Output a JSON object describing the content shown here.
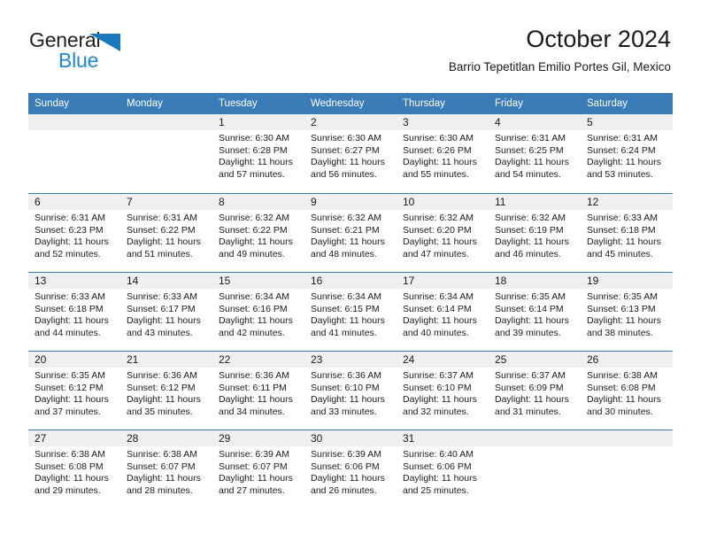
{
  "logo": {
    "word_top": "General",
    "word_bottom": "Blue",
    "triangle_color": "#1878be",
    "text_color": "#231f20",
    "blue_text_color": "#1e87d4"
  },
  "header": {
    "title": "October 2024",
    "subtitle": "Barrio Tepetitlan Emilio Portes Gil, Mexico"
  },
  "colors": {
    "header_blue": "#3a7cb8",
    "day_strip_gray": "#efefef",
    "text": "#1a1a1a",
    "background": "#ffffff"
  },
  "weekdays": [
    "Sunday",
    "Monday",
    "Tuesday",
    "Wednesday",
    "Thursday",
    "Friday",
    "Saturday"
  ],
  "weeks": [
    [
      {
        "day": "",
        "sunrise": "",
        "sunset": "",
        "daylight_line1": "",
        "daylight_line2": ""
      },
      {
        "day": "",
        "sunrise": "",
        "sunset": "",
        "daylight_line1": "",
        "daylight_line2": ""
      },
      {
        "day": "1",
        "sunrise": "Sunrise: 6:30 AM",
        "sunset": "Sunset: 6:28 PM",
        "daylight_line1": "Daylight: 11 hours",
        "daylight_line2": "and 57 minutes."
      },
      {
        "day": "2",
        "sunrise": "Sunrise: 6:30 AM",
        "sunset": "Sunset: 6:27 PM",
        "daylight_line1": "Daylight: 11 hours",
        "daylight_line2": "and 56 minutes."
      },
      {
        "day": "3",
        "sunrise": "Sunrise: 6:30 AM",
        "sunset": "Sunset: 6:26 PM",
        "daylight_line1": "Daylight: 11 hours",
        "daylight_line2": "and 55 minutes."
      },
      {
        "day": "4",
        "sunrise": "Sunrise: 6:31 AM",
        "sunset": "Sunset: 6:25 PM",
        "daylight_line1": "Daylight: 11 hours",
        "daylight_line2": "and 54 minutes."
      },
      {
        "day": "5",
        "sunrise": "Sunrise: 6:31 AM",
        "sunset": "Sunset: 6:24 PM",
        "daylight_line1": "Daylight: 11 hours",
        "daylight_line2": "and 53 minutes."
      }
    ],
    [
      {
        "day": "6",
        "sunrise": "Sunrise: 6:31 AM",
        "sunset": "Sunset: 6:23 PM",
        "daylight_line1": "Daylight: 11 hours",
        "daylight_line2": "and 52 minutes."
      },
      {
        "day": "7",
        "sunrise": "Sunrise: 6:31 AM",
        "sunset": "Sunset: 6:22 PM",
        "daylight_line1": "Daylight: 11 hours",
        "daylight_line2": "and 51 minutes."
      },
      {
        "day": "8",
        "sunrise": "Sunrise: 6:32 AM",
        "sunset": "Sunset: 6:22 PM",
        "daylight_line1": "Daylight: 11 hours",
        "daylight_line2": "and 49 minutes."
      },
      {
        "day": "9",
        "sunrise": "Sunrise: 6:32 AM",
        "sunset": "Sunset: 6:21 PM",
        "daylight_line1": "Daylight: 11 hours",
        "daylight_line2": "and 48 minutes."
      },
      {
        "day": "10",
        "sunrise": "Sunrise: 6:32 AM",
        "sunset": "Sunset: 6:20 PM",
        "daylight_line1": "Daylight: 11 hours",
        "daylight_line2": "and 47 minutes."
      },
      {
        "day": "11",
        "sunrise": "Sunrise: 6:32 AM",
        "sunset": "Sunset: 6:19 PM",
        "daylight_line1": "Daylight: 11 hours",
        "daylight_line2": "and 46 minutes."
      },
      {
        "day": "12",
        "sunrise": "Sunrise: 6:33 AM",
        "sunset": "Sunset: 6:18 PM",
        "daylight_line1": "Daylight: 11 hours",
        "daylight_line2": "and 45 minutes."
      }
    ],
    [
      {
        "day": "13",
        "sunrise": "Sunrise: 6:33 AM",
        "sunset": "Sunset: 6:18 PM",
        "daylight_line1": "Daylight: 11 hours",
        "daylight_line2": "and 44 minutes."
      },
      {
        "day": "14",
        "sunrise": "Sunrise: 6:33 AM",
        "sunset": "Sunset: 6:17 PM",
        "daylight_line1": "Daylight: 11 hours",
        "daylight_line2": "and 43 minutes."
      },
      {
        "day": "15",
        "sunrise": "Sunrise: 6:34 AM",
        "sunset": "Sunset: 6:16 PM",
        "daylight_line1": "Daylight: 11 hours",
        "daylight_line2": "and 42 minutes."
      },
      {
        "day": "16",
        "sunrise": "Sunrise: 6:34 AM",
        "sunset": "Sunset: 6:15 PM",
        "daylight_line1": "Daylight: 11 hours",
        "daylight_line2": "and 41 minutes."
      },
      {
        "day": "17",
        "sunrise": "Sunrise: 6:34 AM",
        "sunset": "Sunset: 6:14 PM",
        "daylight_line1": "Daylight: 11 hours",
        "daylight_line2": "and 40 minutes."
      },
      {
        "day": "18",
        "sunrise": "Sunrise: 6:35 AM",
        "sunset": "Sunset: 6:14 PM",
        "daylight_line1": "Daylight: 11 hours",
        "daylight_line2": "and 39 minutes."
      },
      {
        "day": "19",
        "sunrise": "Sunrise: 6:35 AM",
        "sunset": "Sunset: 6:13 PM",
        "daylight_line1": "Daylight: 11 hours",
        "daylight_line2": "and 38 minutes."
      }
    ],
    [
      {
        "day": "20",
        "sunrise": "Sunrise: 6:35 AM",
        "sunset": "Sunset: 6:12 PM",
        "daylight_line1": "Daylight: 11 hours",
        "daylight_line2": "and 37 minutes."
      },
      {
        "day": "21",
        "sunrise": "Sunrise: 6:36 AM",
        "sunset": "Sunset: 6:12 PM",
        "daylight_line1": "Daylight: 11 hours",
        "daylight_line2": "and 35 minutes."
      },
      {
        "day": "22",
        "sunrise": "Sunrise: 6:36 AM",
        "sunset": "Sunset: 6:11 PM",
        "daylight_line1": "Daylight: 11 hours",
        "daylight_line2": "and 34 minutes."
      },
      {
        "day": "23",
        "sunrise": "Sunrise: 6:36 AM",
        "sunset": "Sunset: 6:10 PM",
        "daylight_line1": "Daylight: 11 hours",
        "daylight_line2": "and 33 minutes."
      },
      {
        "day": "24",
        "sunrise": "Sunrise: 6:37 AM",
        "sunset": "Sunset: 6:10 PM",
        "daylight_line1": "Daylight: 11 hours",
        "daylight_line2": "and 32 minutes."
      },
      {
        "day": "25",
        "sunrise": "Sunrise: 6:37 AM",
        "sunset": "Sunset: 6:09 PM",
        "daylight_line1": "Daylight: 11 hours",
        "daylight_line2": "and 31 minutes."
      },
      {
        "day": "26",
        "sunrise": "Sunrise: 6:38 AM",
        "sunset": "Sunset: 6:08 PM",
        "daylight_line1": "Daylight: 11 hours",
        "daylight_line2": "and 30 minutes."
      }
    ],
    [
      {
        "day": "27",
        "sunrise": "Sunrise: 6:38 AM",
        "sunset": "Sunset: 6:08 PM",
        "daylight_line1": "Daylight: 11 hours",
        "daylight_line2": "and 29 minutes."
      },
      {
        "day": "28",
        "sunrise": "Sunrise: 6:38 AM",
        "sunset": "Sunset: 6:07 PM",
        "daylight_line1": "Daylight: 11 hours",
        "daylight_line2": "and 28 minutes."
      },
      {
        "day": "29",
        "sunrise": "Sunrise: 6:39 AM",
        "sunset": "Sunset: 6:07 PM",
        "daylight_line1": "Daylight: 11 hours",
        "daylight_line2": "and 27 minutes."
      },
      {
        "day": "30",
        "sunrise": "Sunrise: 6:39 AM",
        "sunset": "Sunset: 6:06 PM",
        "daylight_line1": "Daylight: 11 hours",
        "daylight_line2": "and 26 minutes."
      },
      {
        "day": "31",
        "sunrise": "Sunrise: 6:40 AM",
        "sunset": "Sunset: 6:06 PM",
        "daylight_line1": "Daylight: 11 hours",
        "daylight_line2": "and 25 minutes."
      },
      {
        "day": "",
        "sunrise": "",
        "sunset": "",
        "daylight_line1": "",
        "daylight_line2": ""
      },
      {
        "day": "",
        "sunrise": "",
        "sunset": "",
        "daylight_line1": "",
        "daylight_line2": ""
      }
    ]
  ]
}
